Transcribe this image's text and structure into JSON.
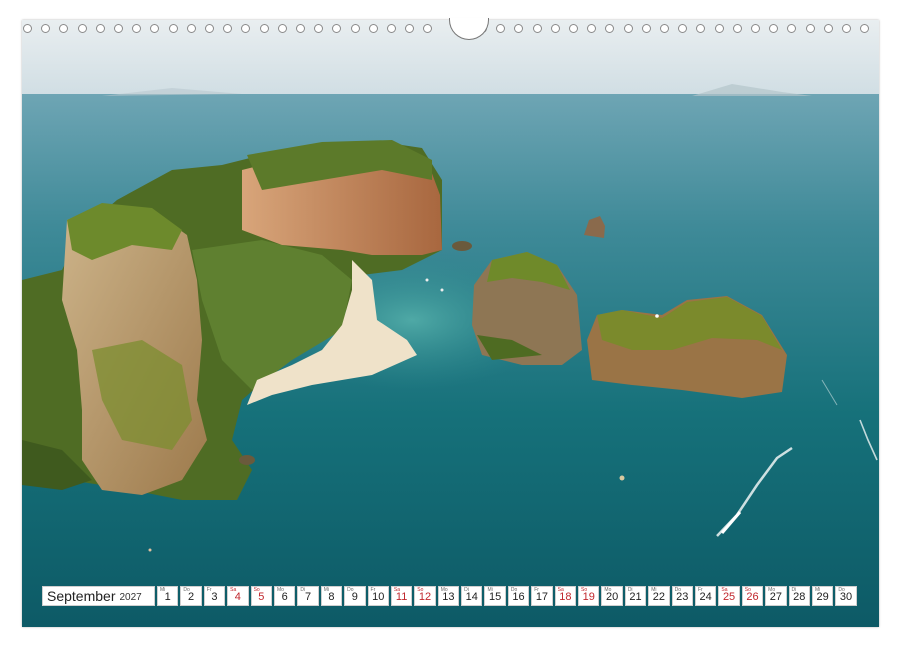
{
  "calendar": {
    "month": "September",
    "year": "2027",
    "days": [
      {
        "n": "1",
        "wd": "Mi",
        "weekend": false
      },
      {
        "n": "2",
        "wd": "Do",
        "weekend": false
      },
      {
        "n": "3",
        "wd": "Fr",
        "weekend": false
      },
      {
        "n": "4",
        "wd": "Sa",
        "weekend": true
      },
      {
        "n": "5",
        "wd": "So",
        "weekend": true
      },
      {
        "n": "6",
        "wd": "Mo",
        "weekend": false
      },
      {
        "n": "7",
        "wd": "Di",
        "weekend": false
      },
      {
        "n": "8",
        "wd": "Mi",
        "weekend": false
      },
      {
        "n": "9",
        "wd": "Do",
        "weekend": false
      },
      {
        "n": "10",
        "wd": "Fr",
        "weekend": false
      },
      {
        "n": "11",
        "wd": "Sa",
        "weekend": true
      },
      {
        "n": "12",
        "wd": "So",
        "weekend": true
      },
      {
        "n": "13",
        "wd": "Mo",
        "weekend": false
      },
      {
        "n": "14",
        "wd": "Di",
        "weekend": false
      },
      {
        "n": "15",
        "wd": "Mi",
        "weekend": false
      },
      {
        "n": "16",
        "wd": "Do",
        "weekend": false
      },
      {
        "n": "17",
        "wd": "Fr",
        "weekend": false
      },
      {
        "n": "18",
        "wd": "Sa",
        "weekend": true
      },
      {
        "n": "19",
        "wd": "So",
        "weekend": true
      },
      {
        "n": "20",
        "wd": "Mo",
        "weekend": false
      },
      {
        "n": "21",
        "wd": "Di",
        "weekend": false
      },
      {
        "n": "22",
        "wd": "Mi",
        "weekend": false
      },
      {
        "n": "23",
        "wd": "Do",
        "weekend": false
      },
      {
        "n": "24",
        "wd": "Fr",
        "weekend": false
      },
      {
        "n": "25",
        "wd": "Sa",
        "weekend": true
      },
      {
        "n": "26",
        "wd": "So",
        "weekend": true
      },
      {
        "n": "27",
        "wd": "Mo",
        "weekend": false
      },
      {
        "n": "28",
        "wd": "Di",
        "weekend": false
      },
      {
        "n": "29",
        "wd": "Mi",
        "weekend": false
      },
      {
        "n": "30",
        "wd": "Do",
        "weekend": false
      }
    ]
  },
  "colors": {
    "weekend": "#c0262c",
    "sea_deep": "#0f5f6c",
    "sea_shallow": "#3f9aa0",
    "sky": "#dfe8ec",
    "rock": "#b98a5a",
    "jungle": "#5e7a2a"
  },
  "photo": {
    "subject": "aerial-coastline-limestone-islands"
  }
}
